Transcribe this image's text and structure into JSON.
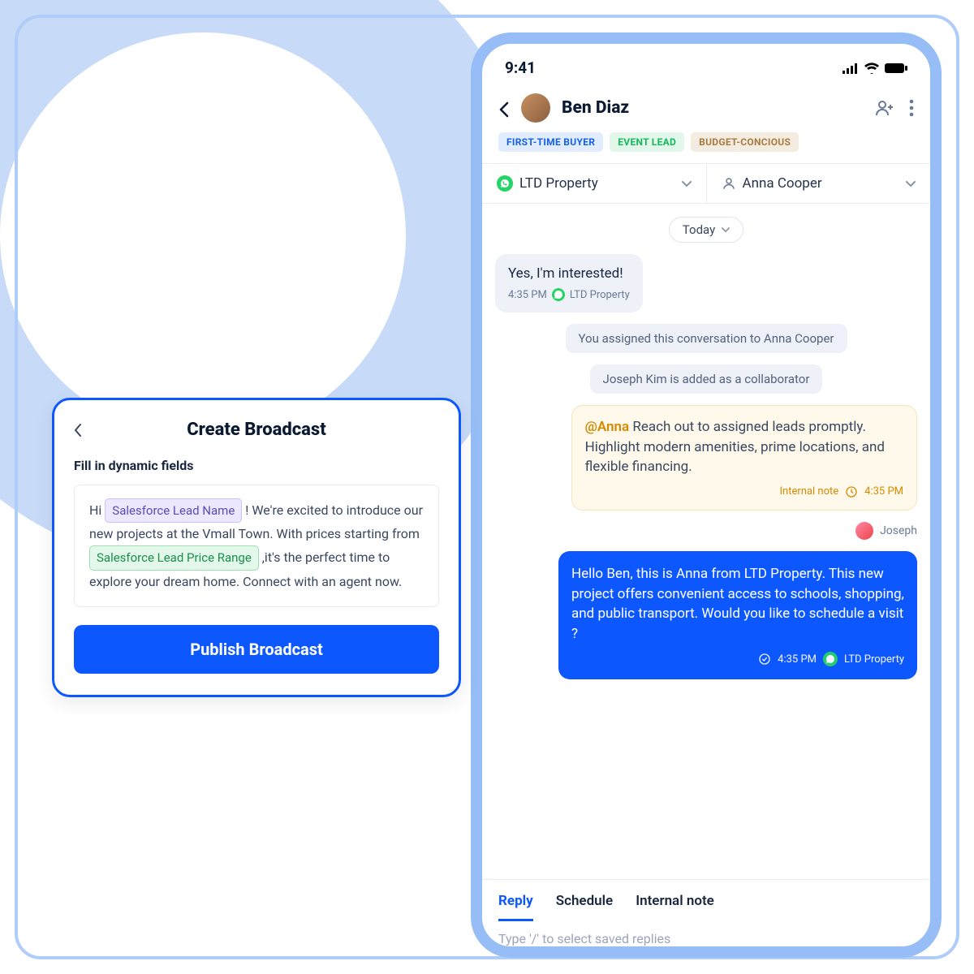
{
  "status": {
    "time": "9:41"
  },
  "contact": {
    "name": "Ben Diaz"
  },
  "tags": [
    {
      "text": "FIRST-TIME BUYER",
      "cls": "blue"
    },
    {
      "text": "EVENT LEAD",
      "cls": "green"
    },
    {
      "text": "BUDGET-CONCIOUS",
      "cls": "brown"
    }
  ],
  "channel": {
    "name": "LTD Property"
  },
  "assignee": {
    "name": "Anna Cooper"
  },
  "today_label": "Today",
  "msg_in": {
    "text": "Yes, I'm interested!",
    "time": "4:35 PM",
    "via": "LTD Property"
  },
  "sys1": "You assigned this conversation to Anna Cooper",
  "sys2": "Joseph Kim is added as a collaborator",
  "note": {
    "mention": "@Anna",
    "text": " Reach out to assigned leads promptly. Highlight modern amenities, prime locations, and flexible financing.",
    "label": "Internal note",
    "time": "4:35 PM"
  },
  "author": {
    "name": "Joseph"
  },
  "msg_out": {
    "text": "Hello Ben, this is Anna from LTD Property. This new project offers convenient access to schools, shopping, and public transport. Would you like to schedule a visit ?",
    "time": "4:35 PM",
    "via": "LTD Property"
  },
  "compose": {
    "tabs": {
      "reply": "Reply",
      "schedule": "Schedule",
      "note": "Internal note"
    },
    "placeholder": "Type '/' to select saved replies"
  },
  "broadcast": {
    "title": "Create Broadcast",
    "subtitle": "Fill in dynamic fields",
    "pre": "Hi ",
    "token1": "Salesforce Lead Name",
    "mid1": " ! We're excited to introduce our new projects at the Vmall Town. With prices starting from ",
    "token2": "Salesforce Lead Price Range",
    "mid2": " ,it's the perfect time to explore your dream home. Connect with an agent now.",
    "button": "Publish Broadcast"
  }
}
